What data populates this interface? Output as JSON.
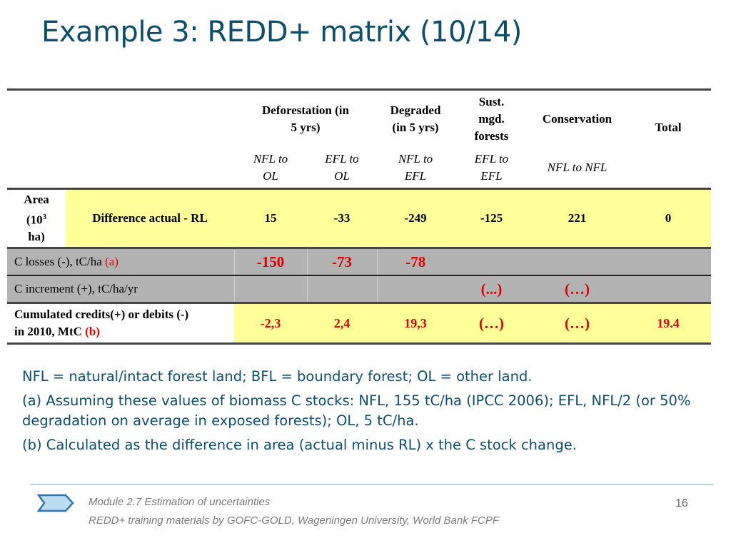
{
  "title": "Example 3: REDD+ matrix (10/14)",
  "table": {
    "groups": {
      "deforestation": "Deforestation (in 5 yrs)",
      "degraded": "Degraded (in 5 yrs)",
      "sust_mgd": "Sust. mgd. forests",
      "conservation": "Conservation",
      "total": "Total"
    },
    "subheaders": {
      "nfl_ol_1": "NFL to",
      "nfl_ol_2": "OL",
      "efl_ol_1": "EFL to",
      "efl_ol_2": "OL",
      "nfl_efl_1": "NFL to",
      "nfl_efl_2": "EFL",
      "efl_efl_1": "EFL to",
      "efl_efl_2": "EFL",
      "nfl_nfl": "NFL to NFL"
    },
    "area": {
      "label_1": "Area",
      "label_2a": "(10",
      "label_2sup": "3",
      "label_3": "ha)",
      "row_label": "Difference actual - RL",
      "values": [
        "15",
        "-33",
        "-249",
        "-125",
        "221",
        "0"
      ]
    },
    "c_losses": {
      "label": "C losses (-), tC/ha ",
      "note": "(a)",
      "values": [
        "-150",
        "-73",
        "-78",
        "",
        "",
        ""
      ]
    },
    "c_increment": {
      "label": "C increment (+), tC/ha/yr",
      "values": [
        "",
        "",
        "",
        "(...)",
        "(…)",
        ""
      ]
    },
    "cumulated": {
      "label_1": "Cumulated credits(+) or debits (-)",
      "label_2": "in 2010, MtC ",
      "note": "(b)",
      "values": [
        "-2,3",
        "2,4",
        "19,3",
        "(…)",
        "(…)",
        "19.4"
      ]
    }
  },
  "notes": [
    "NFL = natural/intact forest land; BFL = boundary forest; OL = other land.",
    "(a) Assuming these values of biomass C stocks: NFL, 155 tC/ha (IPCC 2006); EFL, NFL/2 (or 50% degradation on average in exposed forests); OL, 5 tC/ha.",
    "(b) Calculated as the difference in area (actual minus RL) x the C stock change."
  ],
  "footer": {
    "module": "Module 2.7 Estimation of uncertainties",
    "credits": "REDD+ training materials by GOFC-GOLD, Wageningen University, World Bank FCPF",
    "page": "16"
  }
}
